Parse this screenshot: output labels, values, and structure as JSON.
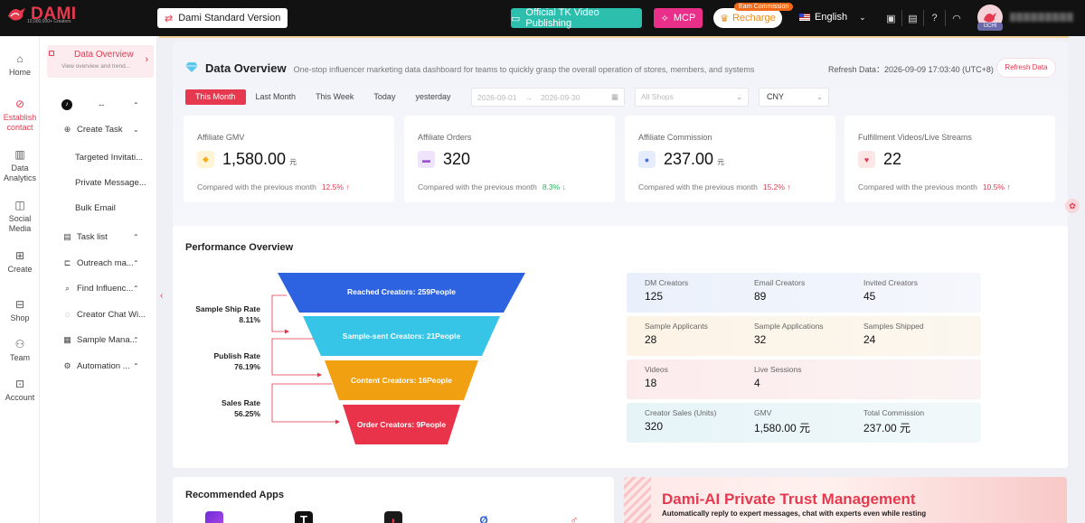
{
  "brand": {
    "name": "DAMI",
    "tagline": "10,000,000+ Creators",
    "accent": "#e6394f"
  },
  "topbar": {
    "version_label": "Dami Standard Version",
    "tk_publishing_label": "Official TK Video Publishing",
    "mcp_label": "MCP",
    "earn_badge": "Earn Commission",
    "recharge_label": "Recharge",
    "language": "English",
    "avatar_tag": "UCHI"
  },
  "rail": [
    {
      "label": "Home",
      "icon": "home-icon"
    },
    {
      "label": "Establish contact",
      "icon": "link-icon",
      "active": true
    },
    {
      "label": "Data Analytics",
      "icon": "chart-icon"
    },
    {
      "label": "Social Media",
      "icon": "social-icon"
    },
    {
      "label": "Create",
      "icon": "create-icon"
    },
    {
      "label": "Shop",
      "icon": "shop-icon"
    },
    {
      "label": "Team",
      "icon": "team-icon"
    },
    {
      "label": "Account",
      "icon": "account-icon"
    }
  ],
  "subnav": {
    "active": {
      "title": "Data Overview",
      "desc": "View overview and trend..."
    },
    "platform": "--",
    "items": [
      {
        "label": "Create Task",
        "arrow": "⌄"
      },
      {
        "label": "Targeted Invitati...",
        "child": true
      },
      {
        "label": "Private Message...",
        "child": true
      },
      {
        "label": "Bulk Email",
        "child": true
      },
      {
        "label": "Task list",
        "arrow": "⌃"
      },
      {
        "label": "Outreach ma...",
        "arrow": "⌃"
      },
      {
        "label": "Find Influenc...",
        "arrow": "⌃"
      },
      {
        "label": "Creator Chat Wi..."
      },
      {
        "label": "Sample Mana...",
        "arrow": "⌃"
      },
      {
        "label": "Automation ...",
        "arrow": "⌃"
      }
    ]
  },
  "overview": {
    "title": "Data Overview",
    "description": "One-stop influencer marketing data dashboard for teams to quickly grasp the overall operation of stores, members, and systems",
    "refresh_text": "Refresh Data：2026-09-09 17:03:40 (UTC+8)",
    "refresh_button": "Refresh Data",
    "tabs": [
      "This Month",
      "Last Month",
      "This Week",
      "Today",
      "yesterday"
    ],
    "date_start": "2026-09-01",
    "date_end": "2026-09-30",
    "shop_placeholder": "All Shops",
    "currency": "CNY",
    "metrics": [
      {
        "label": "Affiliate GMV",
        "value": "1,580.00",
        "unit": "元",
        "compare": "Compared with the previous month",
        "pct": "12.5%",
        "trend": "up",
        "arrow": "↑",
        "icon_bg": "#fff4d6",
        "icon_color": "#f2b01e"
      },
      {
        "label": "Affiliate Orders",
        "value": "320",
        "unit": "",
        "compare": "Compared with the previous month",
        "pct": "8.3%",
        "trend": "down",
        "arrow": "↓",
        "icon_bg": "#efe4fb",
        "icon_color": "#9b52d6"
      },
      {
        "label": "Affiliate Commission",
        "value": "237.00",
        "unit": "元",
        "compare": "Compared with the previous month",
        "pct": "15.2%",
        "trend": "up",
        "arrow": "↑",
        "icon_bg": "#e5ecfb",
        "icon_color": "#4b6fd6"
      },
      {
        "label": "Fulfillment Videos/Live Streams",
        "value": "22",
        "unit": "",
        "compare": "Compared with the previous month",
        "pct": "10.5%",
        "trend": "up",
        "arrow": "↑",
        "icon_bg": "#fde6e6",
        "icon_color": "#e6394f"
      }
    ]
  },
  "performance": {
    "title": "Performance Overview",
    "funnel": [
      {
        "label": "Reached Creators: 259People",
        "color": "#2d63e0"
      },
      {
        "label": "Sample-sent Creators: 21People",
        "color": "#36c5e6"
      },
      {
        "label": "Content Creators: 16People",
        "color": "#f0a010"
      },
      {
        "label": "Order Creators: 9People",
        "color": "#e8334a"
      }
    ],
    "rates": [
      {
        "name": "Sample Ship Rate",
        "value": "8.11%"
      },
      {
        "name": "Publish Rate",
        "value": "76.19%"
      },
      {
        "name": "Sales Rate",
        "value": "56.25%"
      }
    ],
    "stat_rows": [
      {
        "bg": "linear-gradient(90deg,#eaf0fb,#f5f7fc)",
        "items": [
          {
            "label": "DM Creators",
            "value": "125"
          },
          {
            "label": "Email Creators",
            "value": "89"
          },
          {
            "label": "Invited Creators",
            "value": "45"
          }
        ]
      },
      {
        "bg": "linear-gradient(90deg,#fdf4e6,#fbf6ee)",
        "items": [
          {
            "label": "Sample Applicants",
            "value": "28"
          },
          {
            "label": "Sample Applications",
            "value": "32"
          },
          {
            "label": "Samples Shipped",
            "value": "24"
          }
        ]
      },
      {
        "bg": "linear-gradient(90deg,#fcebec,#fbf3f3)",
        "items": [
          {
            "label": "Videos",
            "value": "18"
          },
          {
            "label": "Live Sessions",
            "value": "4"
          }
        ]
      },
      {
        "bg": "linear-gradient(90deg,#e6f4f8,#f1f8fa)",
        "items": [
          {
            "label": "Creator Sales (Units)",
            "value": "320"
          },
          {
            "label": "GMV",
            "value": "1,580.00 元"
          },
          {
            "label": "Total Commission",
            "value": "237.00 元"
          }
        ]
      }
    ]
  },
  "recommended": {
    "title": "Recommended Apps"
  },
  "banner": {
    "title": "Dami-AI Private Trust Management",
    "subtitle": "Automatically reply to expert messages, chat with experts even while resting"
  }
}
